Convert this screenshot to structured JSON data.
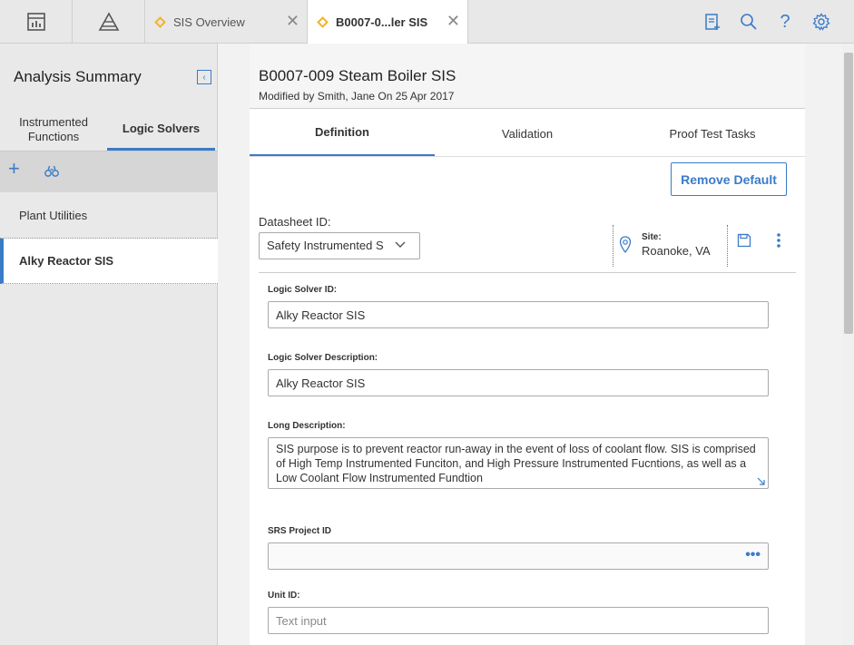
{
  "topbar": {
    "tabs": [
      {
        "label": "SIS Overview",
        "active": false
      },
      {
        "label": "B0007-0...ler SIS",
        "active": true
      }
    ],
    "left_icons": [
      "dashboard-icon",
      "pyramid-icon"
    ],
    "right_icons": [
      "clipboard-add-icon",
      "search-icon",
      "help-icon",
      "settings-icon"
    ]
  },
  "sidebar": {
    "title": "Analysis Summary",
    "tabs": [
      {
        "label": "Instrumented Functions",
        "active": false
      },
      {
        "label": "Logic Solvers",
        "active": true
      }
    ],
    "toolbar_icons": [
      "add-icon",
      "binoculars-icon"
    ],
    "items": [
      {
        "label": "Plant Utilities",
        "selected": false
      },
      {
        "label": "Alky Reactor SIS",
        "selected": true
      }
    ]
  },
  "main": {
    "title": "B0007-009 Steam Boiler SIS",
    "modified": "Modified by Smith, Jane On 25 Apr 2017",
    "tabs": [
      {
        "label": "Definition",
        "active": true
      },
      {
        "label": "Validation",
        "active": false
      },
      {
        "label": "Proof Test Tasks",
        "active": false
      }
    ],
    "remove_default_label": "Remove Default",
    "datasheet": {
      "label": "Datasheet ID:",
      "value": "Safety Instrumented S"
    },
    "site": {
      "label": "Site:",
      "value": "Roanoke, VA"
    },
    "fields": {
      "logic_solver_id": {
        "label": "Logic Solver ID:",
        "value": "Alky Reactor SIS"
      },
      "logic_solver_desc": {
        "label": "Logic Solver Description:",
        "value": "Alky Reactor SIS"
      },
      "long_desc": {
        "label": "Long Description:",
        "value": "SIS purpose is to prevent reactor run-away in the event of loss of coolant flow.  SIS is comprised of High Temp Instrumented Funciton, and High Pressure Instrumented Fucntions, as well as a Low Coolant Flow Instrumented Fundtion"
      },
      "srs_project_id": {
        "label": "SRS Project ID",
        "value": ""
      },
      "unit_id": {
        "label": "Unit ID:",
        "placeholder": "Text input"
      }
    }
  },
  "colors": {
    "accent": "#3a7bc8",
    "tab_diamond": "#f0b429"
  }
}
